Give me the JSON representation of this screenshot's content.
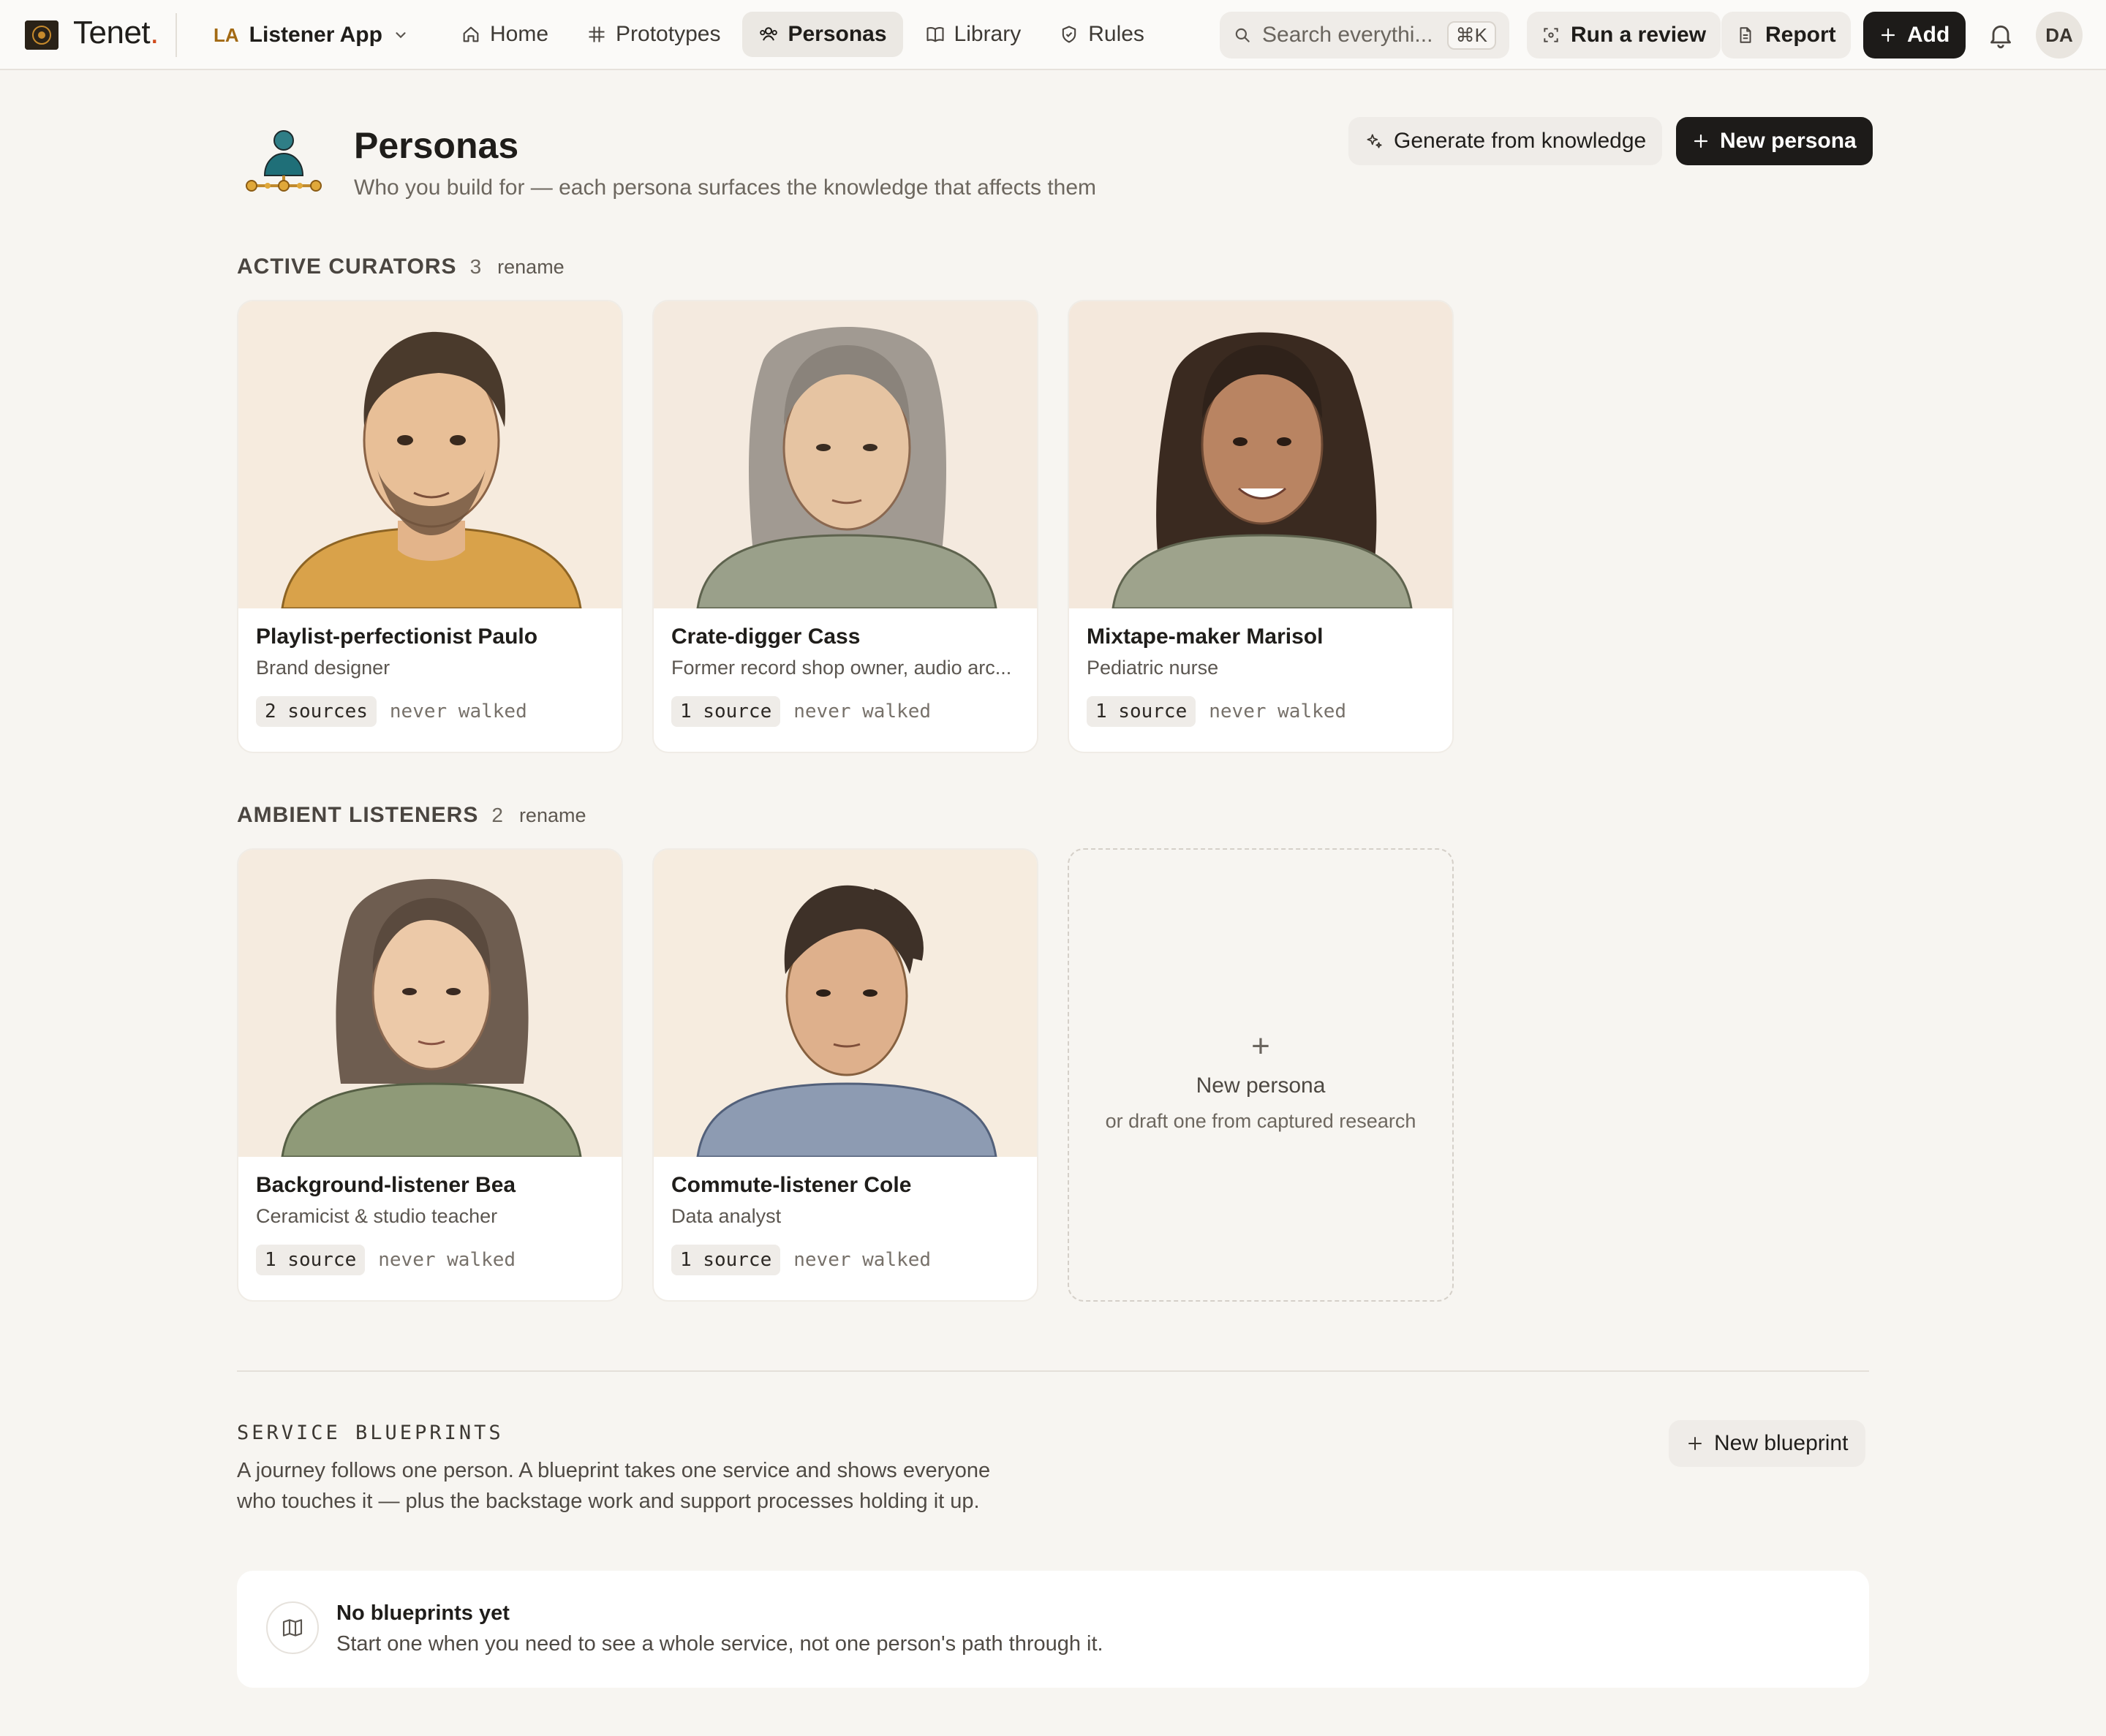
{
  "nav": {
    "logo_text": "Tenet",
    "logo_dot": ".",
    "app_badge": "LA",
    "app_name": "Listener App",
    "items": [
      {
        "label": "Home",
        "icon": "home-icon"
      },
      {
        "label": "Prototypes",
        "icon": "hash-icon"
      },
      {
        "label": "Personas",
        "icon": "personas-icon",
        "active": true
      },
      {
        "label": "Library",
        "icon": "book-icon"
      },
      {
        "label": "Rules",
        "icon": "shield-icon"
      }
    ],
    "search_placeholder": "Search everythi...",
    "search_shortcut": "⌘K",
    "run_review": "Run a review",
    "report": "Report",
    "add": "Add",
    "avatar": "DA"
  },
  "header": {
    "title": "Personas",
    "subtitle": "Who you build for — each persona surfaces the knowledge that affects them",
    "generate_label": "Generate from knowledge",
    "new_persona_label": "New persona"
  },
  "groups": [
    {
      "title": "ACTIVE CURATORS",
      "count": "3",
      "rename": "rename",
      "personas": [
        {
          "name": "Playlist-perfectionist Paulo",
          "role": "Brand designer",
          "sources": "2 sources",
          "walked": "never walked"
        },
        {
          "name": "Crate-digger Cass",
          "role": "Former record shop owner, audio arc...",
          "sources": "1 source",
          "walked": "never walked"
        },
        {
          "name": "Mixtape-maker Marisol",
          "role": "Pediatric nurse",
          "sources": "1 source",
          "walked": "never walked"
        }
      ]
    },
    {
      "title": "AMBIENT LISTENERS",
      "count": "2",
      "rename": "rename",
      "personas": [
        {
          "name": "Background-listener Bea",
          "role": "Ceramicist & studio teacher",
          "sources": "1 source",
          "walked": "never walked"
        },
        {
          "name": "Commute-listener Cole",
          "role": "Data analyst",
          "sources": "1 source",
          "walked": "never walked"
        }
      ]
    }
  ],
  "add_card": {
    "plus": "+",
    "title": "New persona",
    "subtitle": "or draft one from captured research"
  },
  "blueprints": {
    "title": "SERVICE BLUEPRINTS",
    "description": "A journey follows one person. A blueprint takes one service and shows everyone who touches it — plus the backstage work and support processes holding it up.",
    "new_label": "New blueprint",
    "empty_title": "No blueprints yet",
    "empty_text": "Start one when you need to see a whole service, not one person's path through it."
  },
  "colors": {
    "background": "#f7f5f1",
    "primary_button": "#1d1b19",
    "brand_dot": "#d04a1c",
    "app_badge": "#a36a14"
  }
}
